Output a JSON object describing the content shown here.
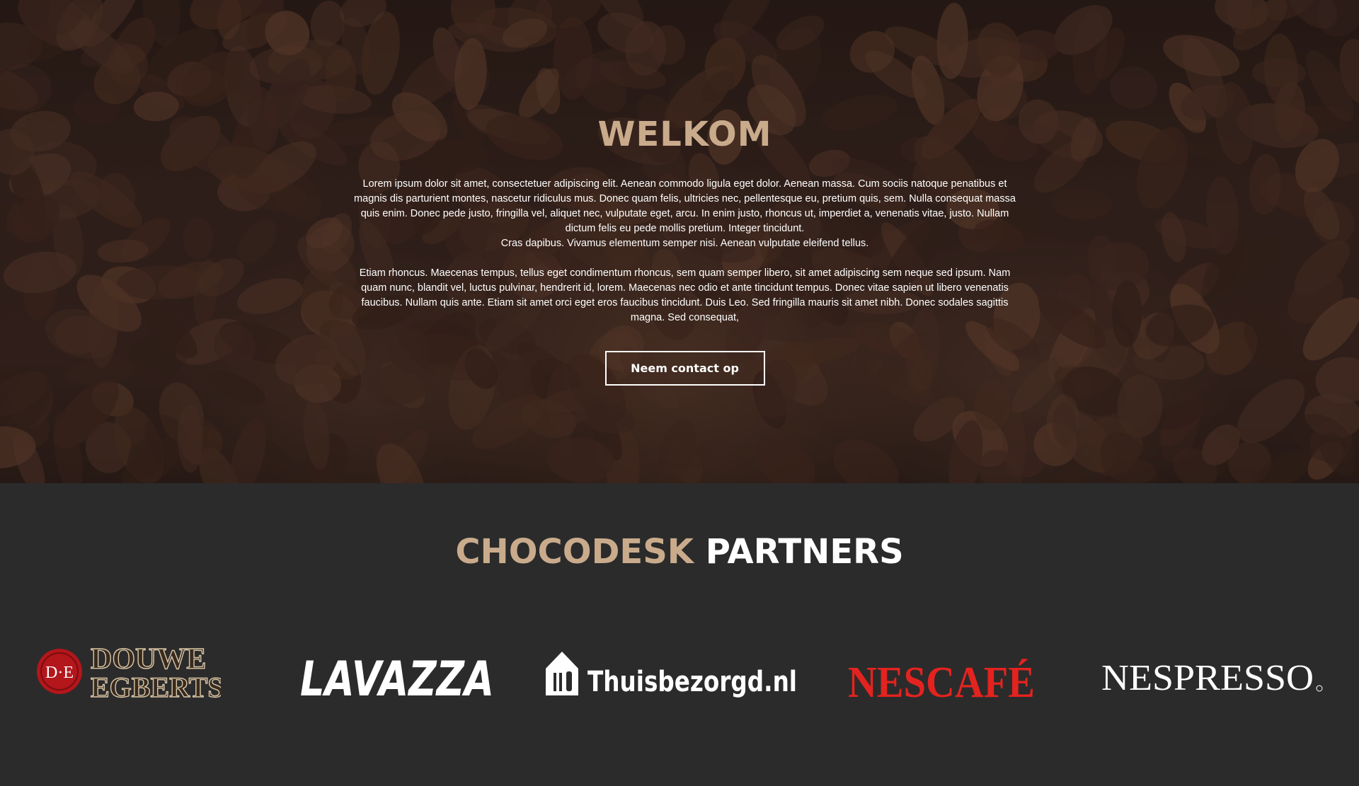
{
  "hero": {
    "title": "WELKOM",
    "paragraph1": "Lorem ipsum dolor sit amet, consectetuer adipiscing elit. Aenean commodo ligula eget dolor. Aenean massa. Cum sociis natoque penatibus et magnis dis parturient montes, nascetur ridiculus mus. Donec quam felis, ultricies nec, pellentesque eu, pretium quis, sem. Nulla consequat massa quis enim. Donec pede justo, fringilla vel, aliquet nec, vulputate eget, arcu. In enim justo, rhoncus ut, imperdiet a, venenatis vitae, justo. Nullam dictum felis eu pede mollis pretium. Integer tincidunt.",
    "paragraph1b": "Cras dapibus. Vivamus elementum semper nisi. Aenean vulputate eleifend tellus.",
    "paragraph2": "Etiam rhoncus. Maecenas tempus, tellus eget condimentum rhoncus, sem quam semper libero, sit amet adipiscing sem neque sed ipsum. Nam quam nunc, blandit vel, luctus pulvinar, hendrerit id, lorem. Maecenas nec odio et ante tincidunt tempus. Donec vitae sapien ut libero venenatis faucibus. Nullam quis ante. Etiam sit amet orci eget eros faucibus tincidunt. Duis Leo. Sed fringilla mauris sit amet nibh. Donec sodales sagittis magna. Sed consequat,",
    "cta_label": "Neem contact op"
  },
  "partners": {
    "title_accent": "CHOCODESK",
    "title_rest": "PARTNERS",
    "logos": [
      {
        "name": "Douwe Egberts",
        "line1": "DOUWE",
        "line2": "EGBERTS",
        "seal": "D·E"
      },
      {
        "name": "Lavazza",
        "text": "LAVAZZA"
      },
      {
        "name": "Thuisbezorgd.nl",
        "text": "Thuisbezorgd.nl"
      },
      {
        "name": "Nescafé",
        "text": "NESCAFÉ"
      },
      {
        "name": "Nespresso",
        "text": "NESPRESSO"
      }
    ]
  },
  "colors": {
    "accent": "#c9ab8c",
    "dark_bg": "#2b2b2b",
    "nescafe_red": "#e3231f",
    "de_red": "#b3161b"
  }
}
